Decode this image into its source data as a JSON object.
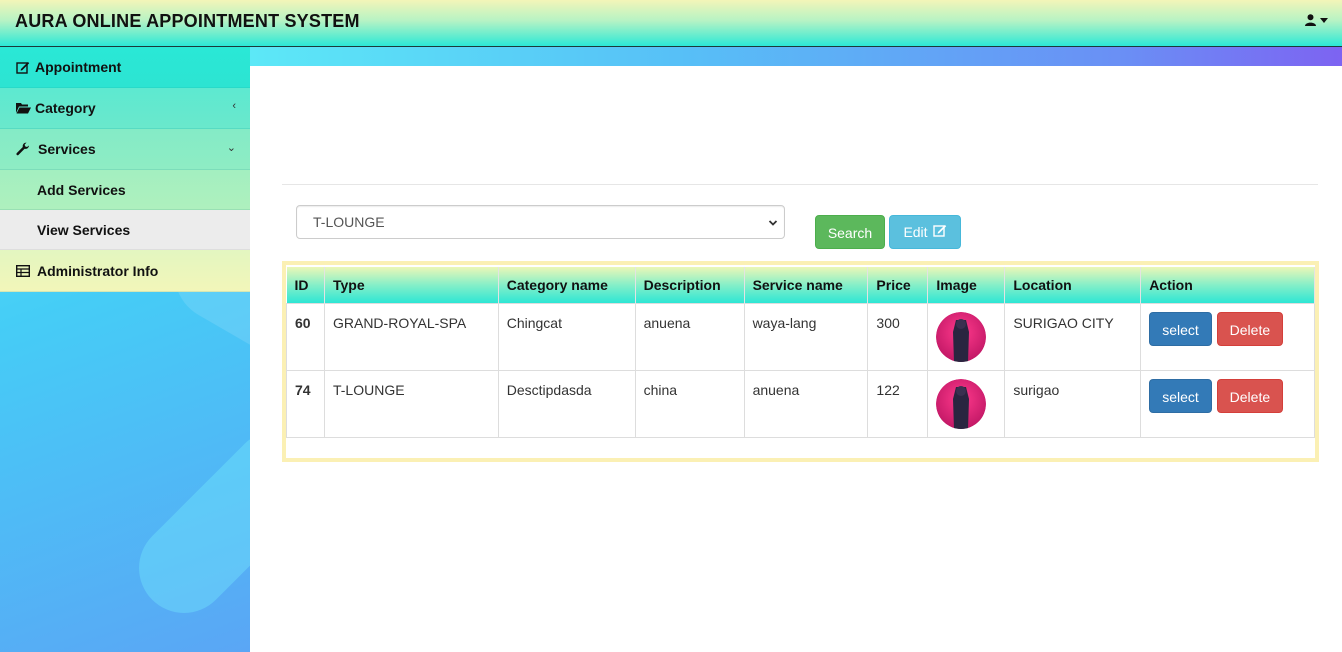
{
  "app": {
    "title": "AURA ONLINE APPOINTMENT SYSTEM"
  },
  "sidebar": {
    "items": [
      {
        "label": "Appointment",
        "icon": "edit-icon"
      },
      {
        "label": "Category",
        "icon": "folder-open-icon",
        "chevron": "‹"
      },
      {
        "label": "Services",
        "icon": "wrench-icon",
        "chevron": "⌄"
      },
      {
        "label": "Add Services"
      },
      {
        "label": "View Services"
      },
      {
        "label": "Administrator Info",
        "icon": "table-icon"
      }
    ]
  },
  "filter": {
    "selected": "T-LOUNGE"
  },
  "buttons": {
    "search": "Search",
    "edit": "Edit"
  },
  "table": {
    "headers": [
      "ID",
      "Type",
      "Category name",
      "Description",
      "Service name",
      "Price",
      "Image",
      "Location",
      "Action"
    ],
    "rows": [
      {
        "id": "60",
        "type": "GRAND-ROYAL-SPA",
        "category": "Chingcat",
        "description": "anuena",
        "service": "waya-lang",
        "price": "300",
        "location": "SURIGAO CITY",
        "select": "select",
        "delete": "Delete"
      },
      {
        "id": "74",
        "type": "T-LOUNGE",
        "category": "Desctipdasda",
        "description": "china",
        "service": "anuena",
        "price": "122",
        "location": "surigao",
        "select": "select",
        "delete": "Delete"
      }
    ]
  },
  "colors": {
    "accent": "#2ce8d6",
    "search": "#5cb85c",
    "edit": "#5bc0de",
    "select": "#337ab7",
    "delete": "#d9534f",
    "panel_border": "#fbf0b4"
  }
}
